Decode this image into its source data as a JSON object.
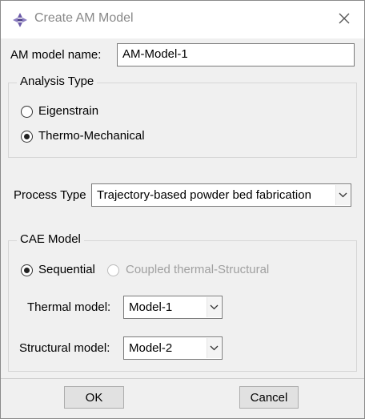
{
  "window": {
    "title": "Create AM Model",
    "app_icon": "abaqus-logo-icon",
    "close_icon": "close-icon"
  },
  "name_field": {
    "label": "AM model name:",
    "value": "AM-Model-1"
  },
  "analysis_type": {
    "legend": "Analysis Type",
    "options": [
      {
        "label": "Eigenstrain",
        "selected": false
      },
      {
        "label": "Thermo-Mechanical",
        "selected": true
      }
    ]
  },
  "process_type": {
    "label": "Process Type",
    "value": "Trajectory-based powder bed fabrication"
  },
  "cae_model": {
    "legend": "CAE Model",
    "options": [
      {
        "label": "Sequential",
        "selected": true,
        "enabled": true
      },
      {
        "label": "Coupled thermal-Structural",
        "selected": false,
        "enabled": false
      }
    ],
    "thermal": {
      "label": "Thermal  model:",
      "value": "Model-1"
    },
    "structural": {
      "label": "Structural model:",
      "value": "Model-2"
    }
  },
  "buttons": {
    "ok": "OK",
    "cancel": "Cancel"
  },
  "colors": {
    "accent": "#6b5aa8",
    "window_bg": "#f0f0f0",
    "disabled_text": "#a0a0a0"
  }
}
